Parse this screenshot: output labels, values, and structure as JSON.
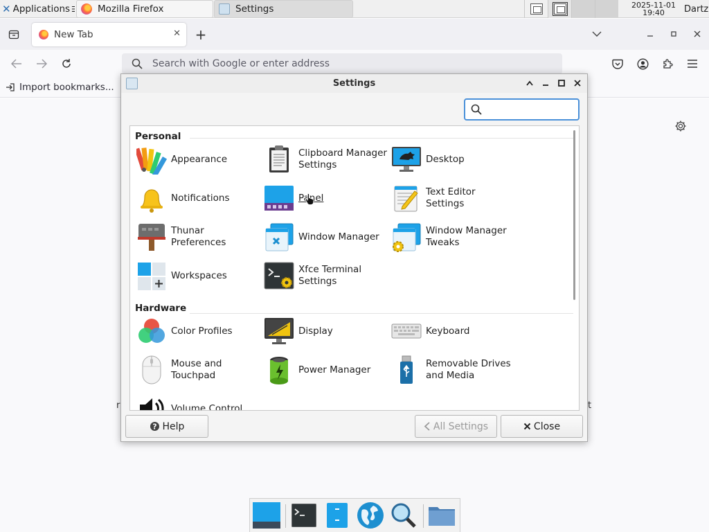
{
  "top_panel": {
    "applications_label": "Applications",
    "tasks": [
      {
        "label": "Mozilla Firefox",
        "icon": "firefox-icon"
      },
      {
        "label": "Settings",
        "icon": "settings-app-icon"
      }
    ],
    "clock": {
      "date": "2025-11-01",
      "time": "19:40"
    },
    "user": "Dartz"
  },
  "firefox": {
    "tab_label": "New Tab",
    "url_placeholder": "Search with Google or enter address",
    "import_bookmarks": "Import bookmarks...",
    "content_fragments": [
      "r",
      "t"
    ]
  },
  "settings": {
    "title": "Settings",
    "search_value": "",
    "categories": [
      {
        "name": "Personal",
        "items": [
          {
            "label": "Appearance",
            "icon": "appearance-icon"
          },
          {
            "label": "Clipboard Manager\nSettings",
            "icon": "clipboard-icon"
          },
          {
            "label": "Desktop",
            "icon": "desktop-icon"
          },
          {
            "label": "Notifications",
            "icon": "bell-icon"
          },
          {
            "label": "Panel",
            "icon": "panel-icon"
          },
          {
            "label": "Text Editor Settings",
            "icon": "text-editor-icon"
          },
          {
            "label": "Thunar Preferences",
            "icon": "thunar-icon"
          },
          {
            "label": "Window Manager",
            "icon": "window-manager-icon"
          },
          {
            "label": "Window Manager\nTweaks",
            "icon": "window-tweaks-icon"
          },
          {
            "label": "Workspaces",
            "icon": "workspaces-icon"
          },
          {
            "label": "Xfce Terminal\nSettings",
            "icon": "terminal-settings-icon"
          }
        ]
      },
      {
        "name": "Hardware",
        "items": [
          {
            "label": "Color Profiles",
            "icon": "color-profiles-icon"
          },
          {
            "label": "Display",
            "icon": "display-icon"
          },
          {
            "label": "Keyboard",
            "icon": "keyboard-icon"
          },
          {
            "label": "Mouse and\nTouchpad",
            "icon": "mouse-icon"
          },
          {
            "label": "Power Manager",
            "icon": "battery-icon"
          },
          {
            "label": "Removable Drives\nand Media",
            "icon": "usb-drive-icon"
          },
          {
            "label": "Volume Control",
            "icon": "speaker-icon"
          }
        ]
      }
    ],
    "buttons": {
      "help": "Help",
      "all_settings": "All Settings",
      "close": "Close"
    }
  },
  "dock": {
    "items": [
      "show-desktop-icon",
      "terminal-icon",
      "file-manager-icon",
      "web-browser-icon",
      "app-finder-icon",
      "folder-icon"
    ]
  },
  "colors": {
    "accent": "#4a90d9",
    "panel_bg": "#f0f0f0",
    "dialog_bg": "#f4f4f4"
  }
}
